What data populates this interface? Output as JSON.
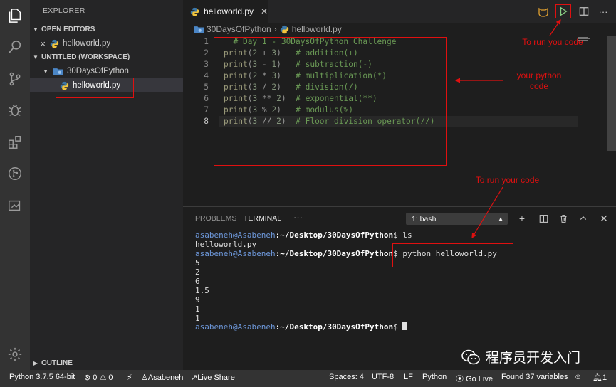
{
  "sidebar": {
    "title": "EXPLORER",
    "open_editors": "OPEN EDITORS",
    "open_file": "helloworld.py",
    "workspace": "UNTITLED (WORKSPACE)",
    "folder": "30DaysOfPython",
    "file": "helloworld.py",
    "outline": "OUTLINE"
  },
  "tab": {
    "label": "helloworld.py"
  },
  "breadcrumb": {
    "folder": "30DaysOfPython",
    "file": "helloworld.py"
  },
  "editor": {
    "line_numbers": [
      "1",
      "2",
      "3",
      "4",
      "5",
      "6",
      "7",
      "8"
    ],
    "lines": [
      {
        "cm": "# Day 1 - 30DaysOfPython Challenge"
      },
      {
        "fn": "print",
        "open": "(",
        "a": "2",
        "op": " + ",
        "b": "3",
        "close": ")",
        "pad": "   ",
        "cm": "# addition(+)"
      },
      {
        "fn": "print",
        "open": "(",
        "a": "3",
        "op": " - ",
        "b": "1",
        "close": ")",
        "pad": "   ",
        "cm": "# subtraction(-)"
      },
      {
        "fn": "print",
        "open": "(",
        "a": "2",
        "op": " * ",
        "b": "3",
        "close": ")",
        "pad": "   ",
        "cm": "# multiplication(*)"
      },
      {
        "fn": "print",
        "open": "(",
        "a": "3",
        "op": " / ",
        "b": "2",
        "close": ")",
        "pad": "   ",
        "cm": "# division(/)"
      },
      {
        "fn": "print",
        "open": "(",
        "a": "3",
        "op": " ** ",
        "b": "2",
        "close": ")",
        "pad": "  ",
        "cm": "# exponential(**)"
      },
      {
        "fn": "print",
        "open": "(",
        "a": "3",
        "op": " % ",
        "b": "2",
        "close": ")",
        "pad": "   ",
        "cm": "# modulus(%)"
      },
      {
        "fn": "print",
        "open": "(",
        "a": "3",
        "op": " // ",
        "b": "2",
        "close": ")",
        "pad": "  ",
        "cm": "# Floor division operator(//)"
      }
    ]
  },
  "panel": {
    "tab_problems": "PROBLEMS",
    "tab_terminal": "TERMINAL",
    "more": "···",
    "shell": "1: bash",
    "user": "asabeneh@Asabeneh",
    "path": ":~/Desktop/30DaysOfPython",
    "prompt_end": "$",
    "cmd1": " ls",
    "out_ls": "helloworld.py",
    "cmd2": "python helloworld.py",
    "outputs": [
      "5",
      "2",
      "6",
      "1.5",
      "9",
      "1",
      "1"
    ]
  },
  "status": {
    "python": "Python 3.7.5 64-bit",
    "errors": "0",
    "warnings": "0",
    "user": "Asabeneh",
    "live_share": "Live Share",
    "spaces": "Spaces: 4",
    "encoding": "UTF-8",
    "eol": "LF",
    "language": "Python",
    "go_live": "Go Live",
    "variables": "Found 37 variables"
  },
  "annotations": {
    "run_code_top": "To run you code",
    "python_code": "your python\ncode",
    "run_code_terminal": "To run your code"
  },
  "watermark": {
    "text": "程序员开发入门"
  },
  "colors": {
    "annotation": "#e01010",
    "activity_bar": "#333333",
    "sidebar": "#252526",
    "editor": "#1e1e1e"
  }
}
